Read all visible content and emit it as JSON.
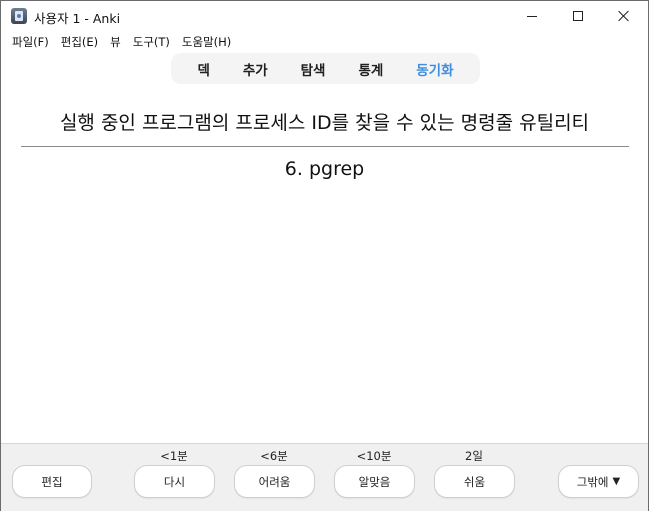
{
  "window": {
    "title": "사용자 1 - Anki"
  },
  "menubar": {
    "items": [
      "파일(F)",
      "편집(E)",
      "뷰",
      "도구(T)",
      "도움말(H)"
    ]
  },
  "toolbar": {
    "tabs": [
      "덱",
      "추가",
      "탐색",
      "통계",
      "동기화"
    ],
    "sync_color": "#3b8ee0"
  },
  "card": {
    "question": "실행 중인 프로그램의 프로세스 ID를 찾을 수 있는 명령줄 유틸리티",
    "answer": "6. pgrep"
  },
  "bottombar": {
    "edit_label": "편집",
    "intervals": {
      "again": "<1분",
      "hard": "<6분",
      "good": "<10분",
      "easy": "2일"
    },
    "answers": {
      "again": "다시",
      "hard": "어려움",
      "good": "알맞음",
      "easy": "쉬움"
    },
    "more_label": "그밖에",
    "more_icon": "triangle-down"
  }
}
